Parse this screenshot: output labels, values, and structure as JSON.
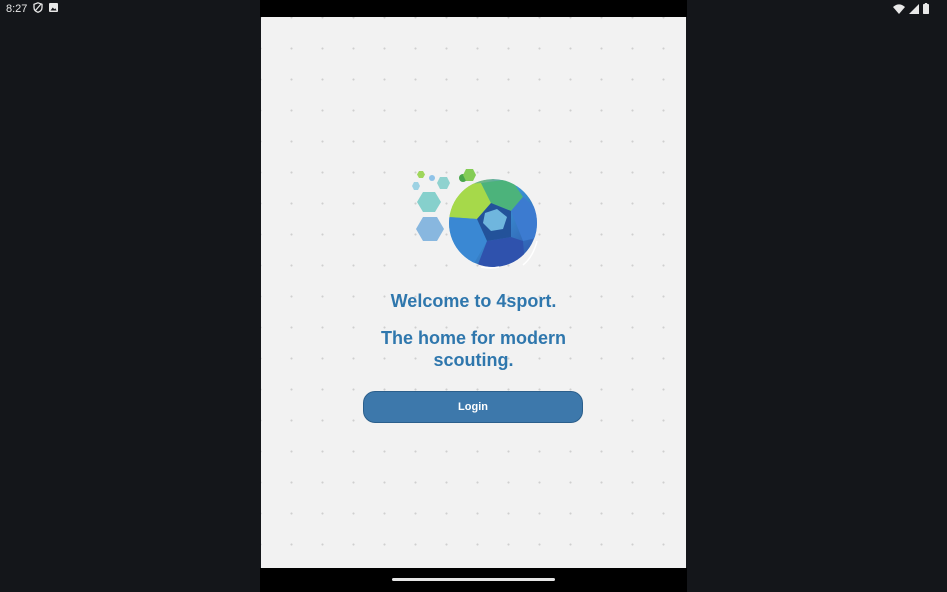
{
  "status_bar": {
    "time": "8:27",
    "left_icons": [
      "shield-icon",
      "image-notification-icon"
    ],
    "right_icons": [
      "wifi-icon",
      "cell-signal-icon",
      "battery-icon"
    ]
  },
  "app": {
    "logo_icon": "4sport-ball-logo-icon",
    "welcome_text": "Welcome to 4sport.",
    "tagline_text": "The home for modern scouting.",
    "login_label": "Login",
    "colors": {
      "primary_text": "#2f77ad",
      "button": "#3d78ab",
      "background": "#f2f2f2"
    }
  }
}
